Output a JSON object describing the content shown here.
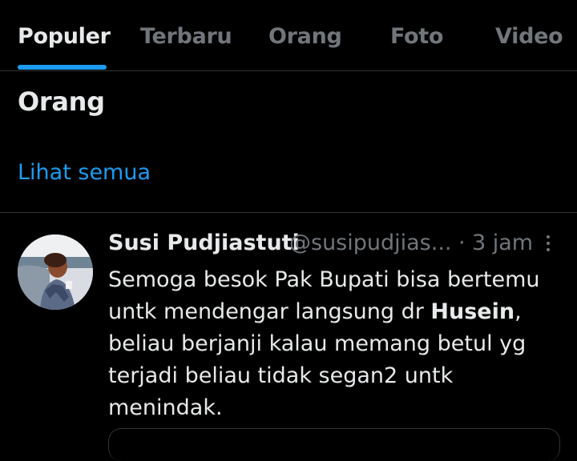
{
  "tabs": [
    {
      "label": "Populer",
      "active": true
    },
    {
      "label": "Terbaru",
      "active": false
    },
    {
      "label": "Orang",
      "active": false
    },
    {
      "label": "Foto",
      "active": false
    },
    {
      "label": "Video",
      "active": false
    }
  ],
  "people_section": {
    "title": "Orang",
    "see_all": "Lihat semua"
  },
  "tweet": {
    "name": "Susi Pudjiastuti",
    "handle": "@susipudjias...",
    "separator": "·",
    "time": "3 jam",
    "more_icon": "more-vertical-icon",
    "lines": [
      {
        "before": "Semoga besok Pak Bupati bisa bertemu",
        "bold": "",
        "after": ""
      },
      {
        "before": "untk mendengar langsung dr ",
        "bold": "Husein",
        "after": ","
      },
      {
        "before": "beliau berjanji kalau memang betul yg",
        "bold": "",
        "after": ""
      },
      {
        "before": "terjadi beliau tidak segan2 untk",
        "bold": "",
        "after": ""
      },
      {
        "before": "menindak.",
        "bold": "",
        "after": ""
      }
    ]
  },
  "colors": {
    "background": "#000000",
    "accent": "#1d9bf0",
    "text_primary": "#e7e9ea",
    "text_secondary": "#71767b",
    "border": "#2f3336"
  }
}
